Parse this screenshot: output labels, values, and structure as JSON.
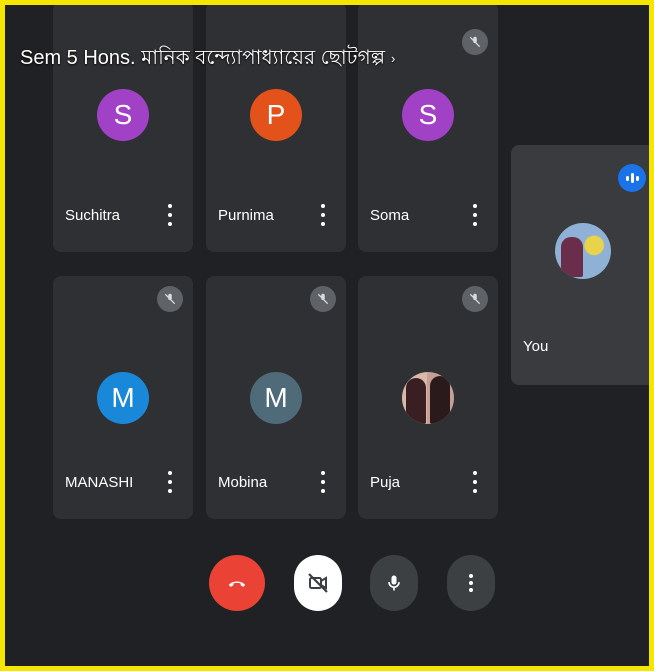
{
  "meeting": {
    "title": "Sem 5 Hons. মানিক বন্দ্যোপাধ্যায়ের ছোটগল্প",
    "title_chevron": "›"
  },
  "participants": [
    {
      "name": "Suchitra",
      "initial": "S",
      "color": "#a142c6",
      "muted": false
    },
    {
      "name": "Purnima",
      "initial": "P",
      "color": "#e4521b",
      "muted": false
    },
    {
      "name": "Soma",
      "initial": "S",
      "color": "#a142c6",
      "muted": true
    },
    {
      "name": "MANASHI",
      "initial": "M",
      "color": "#1a88d8",
      "muted": true
    },
    {
      "name": "Mobina",
      "initial": "M",
      "color": "#4f6b79",
      "muted": true
    },
    {
      "name": "Puja",
      "initial": "",
      "color": "",
      "muted": true
    }
  ],
  "self_tile": {
    "name": "You",
    "speaking": true
  },
  "controls": {
    "end_call_color": "#ea4335",
    "camera_off_color": "#ffffff",
    "mic_color": "#3c4043",
    "more_color": "#3c4043"
  },
  "icons": [
    "mic-off-icon",
    "more-vert-icon",
    "end-call-icon",
    "videocam-off-icon",
    "mic-icon",
    "speaking-icon"
  ]
}
